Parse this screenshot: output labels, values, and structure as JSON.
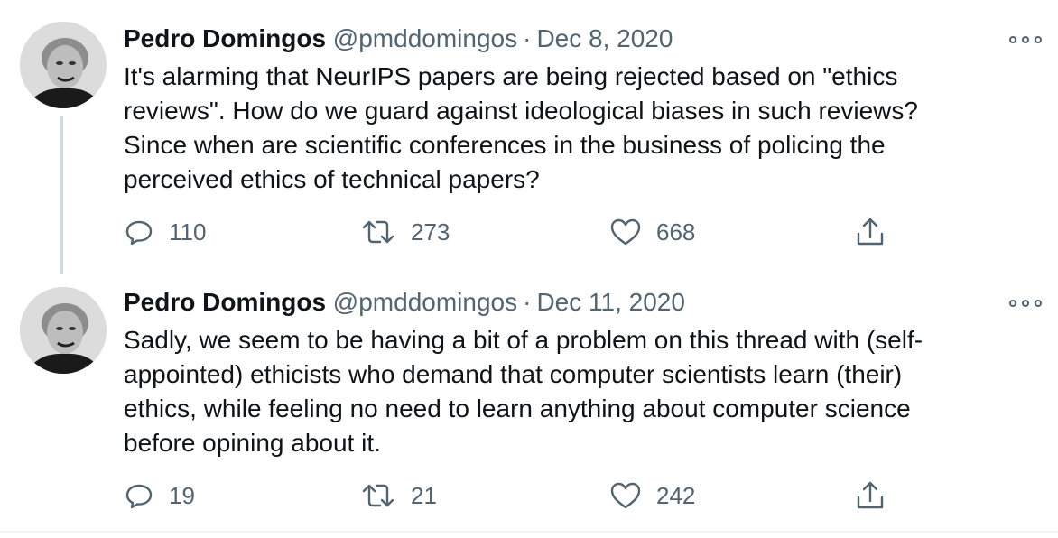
{
  "tweets": [
    {
      "author_name": "Pedro Domingos",
      "handle": "@pmddomingos",
      "date": "Dec 8, 2020",
      "text_lines": [
        "It's alarming that NeurIPS papers are being rejected based on \"ethics",
        "reviews\". How do we guard against ideological biases in such reviews?",
        "Since when are scientific conferences in the business of policing the",
        "perceived ethics of technical papers?"
      ],
      "replies": "110",
      "retweets": "273",
      "likes": "668"
    },
    {
      "author_name": "Pedro Domingos",
      "handle": "@pmddomingos",
      "date": "Dec 11, 2020",
      "text_lines": [
        "Sadly, we seem to be having a bit of a problem on this thread with (self-",
        "appointed) ethicists who demand that computer scientists learn (their)",
        "ethics, while feeling no need to learn anything about computer science",
        "before opining about it."
      ],
      "replies": "19",
      "retweets": "21",
      "likes": "242"
    }
  ],
  "separator": "·",
  "colors": {
    "text": "#0f1419",
    "secondary": "#536471",
    "thread_line": "#cfd9de"
  },
  "icons": [
    "more-icon",
    "reply-icon",
    "retweet-icon",
    "like-icon",
    "share-icon"
  ]
}
